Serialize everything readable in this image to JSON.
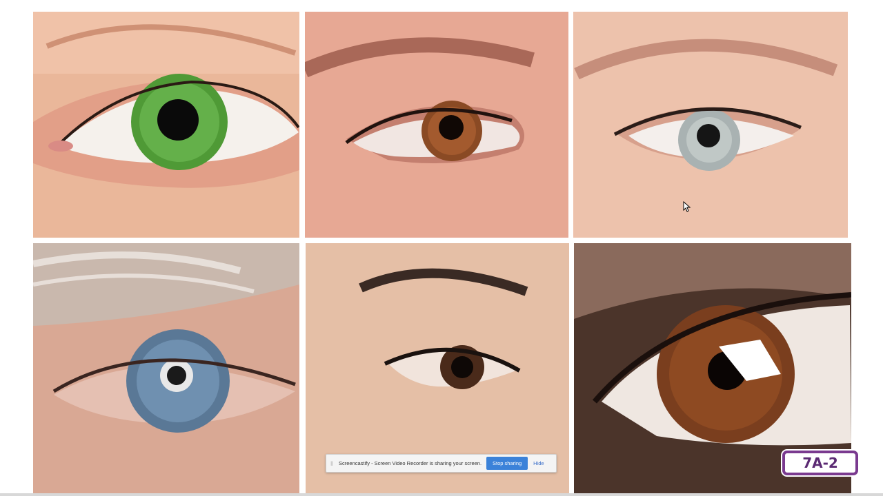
{
  "photos": [
    {
      "id": "green-eye",
      "iris_color": "#4f9a36"
    },
    {
      "id": "brown-eye",
      "iris_color": "#8a4a24"
    },
    {
      "id": "grey-eye",
      "iris_color": "#a9b2b2"
    },
    {
      "id": "blue-eye",
      "iris_color": "#5a7896"
    },
    {
      "id": "dark-brown-eye",
      "iris_color": "#4a2a1a"
    },
    {
      "id": "large-brown-eye",
      "iris_color": "#7a3e1e"
    }
  ],
  "screen_share_bar": {
    "grip": "‖",
    "message": "Screencastify - Screen Video Recorder is sharing your screen.",
    "stop_label": "Stop sharing",
    "hide_label": "Hide",
    "button_color": "#3b82d9"
  },
  "badge": {
    "label": "7A-2",
    "border_color": "#7a3a8f"
  }
}
